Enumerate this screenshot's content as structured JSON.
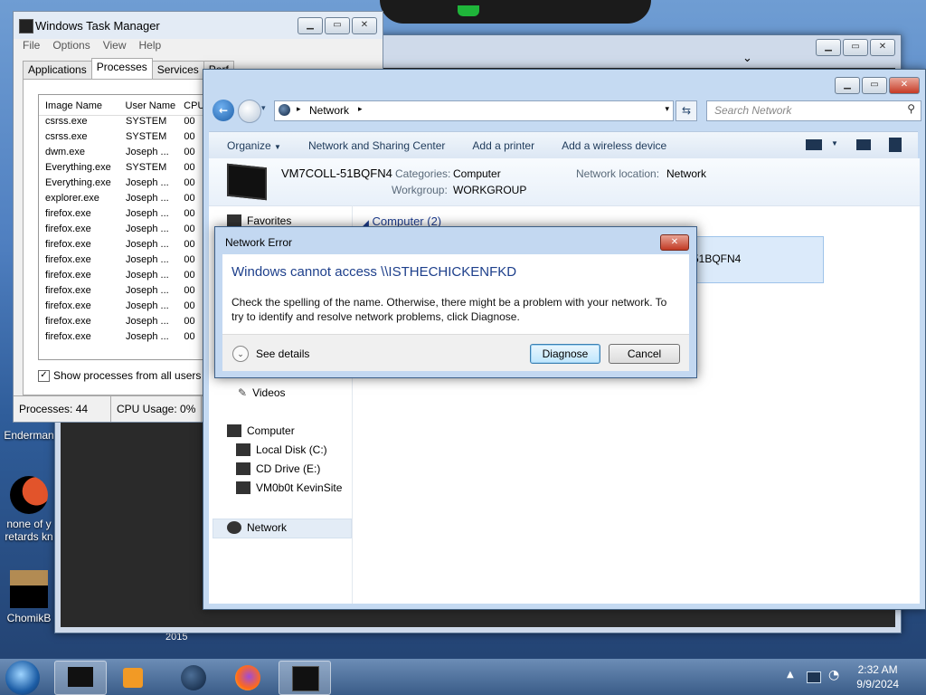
{
  "desktop": {
    "icons": [
      {
        "label": "Enderman"
      },
      {
        "label": "none of y\nretards kn"
      },
      {
        "label": "ChomikB"
      }
    ],
    "year_text": "2015"
  },
  "task_manager": {
    "title": "Windows Task Manager",
    "menu": [
      "File",
      "Options",
      "View",
      "Help"
    ],
    "tabs": [
      "Applications",
      "Processes",
      "Services",
      "Perf"
    ],
    "active_tab": "Processes",
    "columns": [
      "Image Name",
      "User Name",
      "CPU"
    ],
    "rows": [
      {
        "image": "csrss.exe",
        "user": "SYSTEM",
        "cpu": "00"
      },
      {
        "image": "csrss.exe",
        "user": "SYSTEM",
        "cpu": "00"
      },
      {
        "image": "dwm.exe",
        "user": "Joseph ...",
        "cpu": "00"
      },
      {
        "image": "Everything.exe",
        "user": "SYSTEM",
        "cpu": "00"
      },
      {
        "image": "Everything.exe",
        "user": "Joseph ...",
        "cpu": "00"
      },
      {
        "image": "explorer.exe",
        "user": "Joseph ...",
        "cpu": "00"
      },
      {
        "image": "firefox.exe",
        "user": "Joseph ...",
        "cpu": "00"
      },
      {
        "image": "firefox.exe",
        "user": "Joseph ...",
        "cpu": "00"
      },
      {
        "image": "firefox.exe",
        "user": "Joseph ...",
        "cpu": "00"
      },
      {
        "image": "firefox.exe",
        "user": "Joseph ...",
        "cpu": "00"
      },
      {
        "image": "firefox.exe",
        "user": "Joseph ...",
        "cpu": "00"
      },
      {
        "image": "firefox.exe",
        "user": "Joseph ...",
        "cpu": "00"
      },
      {
        "image": "firefox.exe",
        "user": "Joseph ...",
        "cpu": "00"
      },
      {
        "image": "firefox.exe",
        "user": "Joseph ...",
        "cpu": "00"
      },
      {
        "image": "firefox.exe",
        "user": "Joseph ...",
        "cpu": "00"
      }
    ],
    "show_all_label": "Show processes from all users",
    "show_all_checked": true,
    "status_processes": "Processes: 44",
    "status_cpu": "CPU Usage: 0%"
  },
  "explorer": {
    "breadcrumb": "Network",
    "search_placeholder": "Search Network",
    "commands": [
      "Organize",
      "Network and Sharing Center",
      "Add a printer",
      "Add a wireless device"
    ],
    "details": {
      "computer_name": "VM7COLL-51BQFN4",
      "categories_label": "Categories:",
      "categories_value": "Computer",
      "workgroup_label": "Workgroup:",
      "workgroup_value": "WORKGROUP",
      "location_label": "Network location:",
      "location_value": "Network"
    },
    "group_header": "Computer (2)",
    "item_partial": "-51BQFN4",
    "nav": {
      "favorites": "Favorites",
      "videos": "Videos",
      "computer": "Computer",
      "local_disk": "Local Disk (C:)",
      "cd_drive": "CD Drive (E:)",
      "site": "VM0b0t KevinSite",
      "network": "Network"
    }
  },
  "dialog": {
    "title": "Network Error",
    "headline": "Windows cannot access \\\\ISTHECHICKENFKD",
    "message": "Check the spelling of the name. Otherwise, there might be a problem with your network. To try to identify and resolve network problems, click Diagnose.",
    "see_details": "See details",
    "diagnose": "Diagnose",
    "cancel": "Cancel"
  },
  "taskbar": {
    "time": "2:32 AM",
    "date": "9/9/2024"
  },
  "colors": {
    "dialog_headline": "#1d3f8b",
    "close_red": "#c63a25"
  }
}
